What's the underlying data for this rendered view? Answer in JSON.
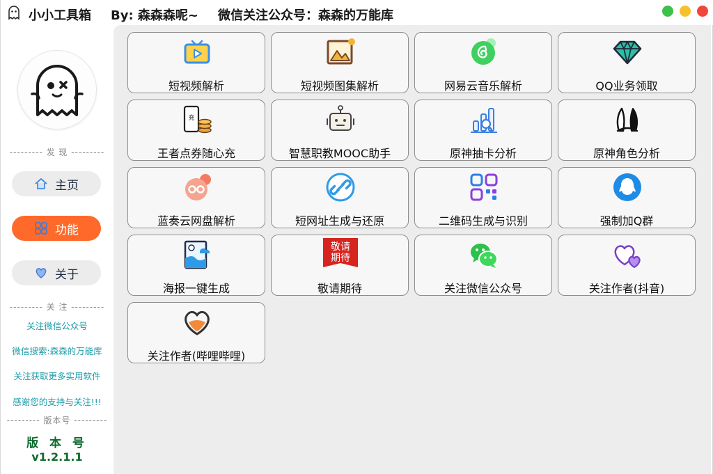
{
  "window": {
    "app_name": "小小工具箱",
    "author": "By: 森森森呢~",
    "wechat_note": "微信关注公众号：森森的万能库",
    "controls": [
      {
        "name": "maximize",
        "color": "#3cc24a"
      },
      {
        "name": "minimize",
        "color": "#f6c12b"
      },
      {
        "name": "close",
        "color": "#f0463c"
      }
    ]
  },
  "sidebar": {
    "section_discover": "--------- 发 现 ---------",
    "nav": [
      {
        "label": "主页",
        "icon": "home-icon",
        "active": false
      },
      {
        "label": "功能",
        "icon": "grid-icon",
        "active": true
      },
      {
        "label": "关于",
        "icon": "heart-icon",
        "active": false
      }
    ],
    "section_follow": "--------- 关 注 ---------",
    "follow_links": [
      "关注微信公众号",
      "微信搜索:森森的万能库",
      "关注获取更多实用软件",
      "感谢您的支持与关注!!!"
    ],
    "section_version": "--------- 版本号 ---------",
    "version_label": "版 本 号",
    "version_number": "v1.2.1.1"
  },
  "tools": [
    {
      "label": "短视频解析",
      "icon": "tv-play-icon"
    },
    {
      "label": "短视频图集解析",
      "icon": "picture-frame-icon"
    },
    {
      "label": "网易云音乐解析",
      "icon": "netease-music-icon"
    },
    {
      "label": "QQ业务领取",
      "icon": "diamond-icon"
    },
    {
      "label": "王者点券随心充",
      "icon": "phone-coins-icon"
    },
    {
      "label": "智慧职教MOOC助手",
      "icon": "robot-icon"
    },
    {
      "label": "原神抽卡分析",
      "icon": "bar-chart-icon"
    },
    {
      "label": "原神角色分析",
      "icon": "rabbit-ears-icon"
    },
    {
      "label": "蓝奏云网盘解析",
      "icon": "cloud-link-icon"
    },
    {
      "label": "短网址生成与还原",
      "icon": "chain-link-icon"
    },
    {
      "label": "二维码生成与识别",
      "icon": "qrcode-icon"
    },
    {
      "label": "强制加Q群",
      "icon": "qq-penguin-icon"
    },
    {
      "label": "海报一键生成",
      "icon": "poster-icon"
    },
    {
      "label": "敬请期待",
      "icon": "coming-soon-icon",
      "badge_lines": [
        "敬请",
        "期待"
      ]
    },
    {
      "label": "关注微信公众号",
      "icon": "wechat-icon"
    },
    {
      "label": "关注作者(抖音)",
      "icon": "double-heart-icon"
    },
    {
      "label": "关注作者(哔哩哔哩)",
      "icon": "heart-outline-icon"
    }
  ],
  "colors": {
    "accent": "#ff6a2a",
    "link": "#1a9aa8",
    "version": "#0d6b2e",
    "panel_bg": "#ededed",
    "tile_border": "#8d8d8d"
  }
}
